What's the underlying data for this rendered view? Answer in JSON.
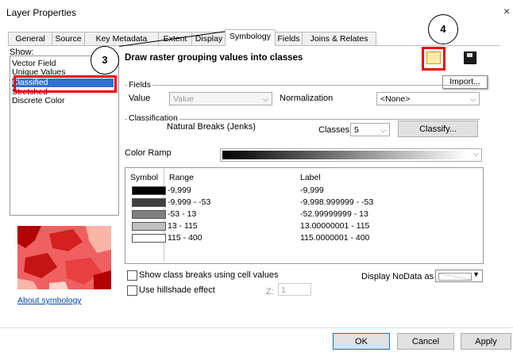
{
  "window": {
    "title": "Layer Properties",
    "close": "×"
  },
  "tabs": [
    "General",
    "Source",
    "Key Metadata",
    "Extent",
    "Display",
    "Symbology",
    "Fields",
    "Joins & Relates"
  ],
  "show": {
    "label": "Show:",
    "items": [
      "Vector Field",
      "Unique Values",
      "Classified",
      "Stretched",
      "Discrete Color"
    ],
    "selected": "Classified"
  },
  "heading": "Draw raster grouping values into classes",
  "callouts": {
    "three": "3",
    "four": "4"
  },
  "import_tooltip": "Import...",
  "fields": {
    "group_label": "Fields",
    "value_label": "Value",
    "value_selected": "Value",
    "normalization_label": "Normalization",
    "normalization_selected": "<None>"
  },
  "classification": {
    "group_label": "Classification",
    "method": "Natural Breaks (Jenks)",
    "classes_label": "Classes",
    "classes_value": "5",
    "classify_button": "Classify..."
  },
  "color_ramp_label": "Color Ramp",
  "table": {
    "headers": {
      "symbol": "Symbol",
      "range": "Range",
      "label": "Label"
    },
    "rows": [
      {
        "color": "#000000",
        "range": "-9,999",
        "label": "-9,999"
      },
      {
        "color": "#404040",
        "range": "-9,999 - -53",
        "label": "-9,998.999999 - -53"
      },
      {
        "color": "#808080",
        "range": "-53 - 13",
        "label": "-52.99999999 - 13"
      },
      {
        "color": "#bfbfbf",
        "range": "13 - 115",
        "label": "13.00000001 - 115"
      },
      {
        "color": "#ffffff",
        "range": "115 - 400",
        "label": "115.0000001 - 400"
      }
    ]
  },
  "options": {
    "show_breaks": "Show class breaks using cell values",
    "hillshade": "Use hillshade effect",
    "z_label": "Z:",
    "z_value": "1",
    "nodata_label": "Display NoData as"
  },
  "about_link": "About symbology",
  "buttons": {
    "ok": "OK",
    "cancel": "Cancel",
    "apply": "Apply"
  }
}
